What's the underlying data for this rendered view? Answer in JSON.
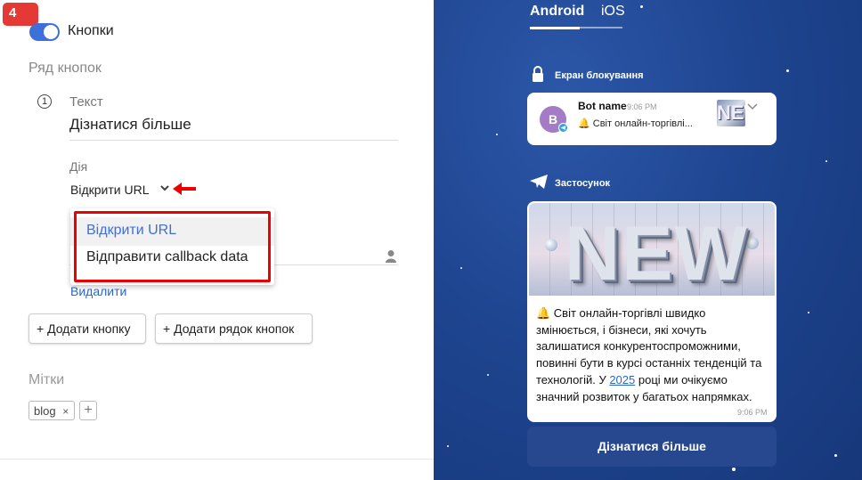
{
  "badge": "4",
  "buttons_toggle": {
    "label": "Кнопки",
    "on": true
  },
  "row_section": {
    "title": "Ряд кнопок"
  },
  "button_item": {
    "number": "1",
    "text_label": "Текст",
    "text_value": "Дізнатися більше",
    "action_label": "Дія",
    "action_value": "Відкрити URL",
    "delete_label": "Видалити"
  },
  "action_dropdown": {
    "options": [
      "Відкрити URL",
      "Відправити callback data"
    ],
    "selected_index": 0
  },
  "actions": {
    "add_button": "+ Додати кнопку",
    "add_row": "+ Додати рядок кнопок"
  },
  "tags_section": {
    "title": "Мітки",
    "tags": [
      "blog"
    ],
    "remove_symbol": "×",
    "add_symbol": "+"
  },
  "preview": {
    "tabs": [
      "Android",
      "iOS"
    ],
    "active_tab": "Android",
    "lock_screen_title": "Екран блокування",
    "notification": {
      "avatar_letter": "B",
      "bot_name": "Bot name",
      "time": "9:06 PM",
      "text": "🔔 Світ онлайн-торгівлі..."
    },
    "app_title": "Застосунок",
    "message": {
      "image_text": "NEW",
      "text_before": "🔔 Світ онлайн-торгівлі швидко змінюється, і бізнеси, які хочуть залишатися конкурентоспроможними, повинні бути в курсі останніх тенденцій та технологій. У ",
      "link_text": "2025",
      "text_after": " році ми очікуємо значний розвиток у багатьох напрямках.",
      "time": "9:06 PM"
    },
    "inline_button": "Дізнатися більше"
  },
  "colors": {
    "accent": "#3f6fd8",
    "link": "#2c68c8",
    "highlight": "#e53935",
    "preview_bg": "#1e4590"
  }
}
